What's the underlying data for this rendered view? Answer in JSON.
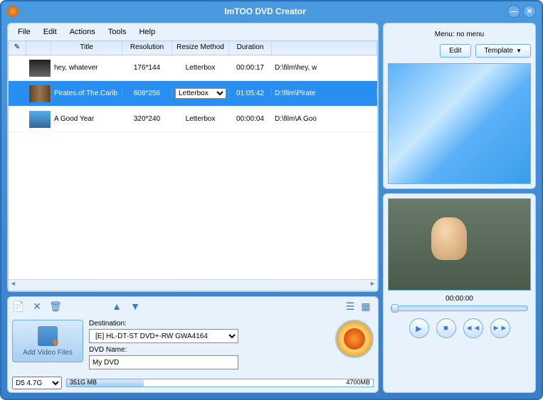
{
  "app_title": "ImTOO DVD Creator",
  "menubar": [
    "File",
    "Edit",
    "Actions",
    "Tools",
    "Help"
  ],
  "columns": {
    "edit": "",
    "thumb": "",
    "title": "Title",
    "resolution": "Resolution",
    "resize": "Resize Method",
    "duration": "Duration",
    "path": ""
  },
  "rows": [
    {
      "title": "hey, whatever",
      "res": "176*144",
      "resize": "Letterbox",
      "duration": "00:00:17",
      "path": "D:\\film\\hey, w"
    },
    {
      "title": "Pirates.of.The.Carib",
      "res": "608*256",
      "resize": "Letterbox",
      "duration": "01:05:42",
      "path": "D:\\film\\Pirate"
    },
    {
      "title": "A Good Year",
      "res": "320*240",
      "resize": "Letterbox",
      "duration": "00:00:04",
      "path": "D:\\film\\A Goo"
    }
  ],
  "resize_options": [
    "Letterbox"
  ],
  "add_button": "Add Video Files",
  "destination_label": "Destination:",
  "destination_value": "[E] HL-DT-ST DVD+-RW GWA4164",
  "dvdname_label": "DVD Name:",
  "dvdname_value": "My DVD",
  "capacity_type": "D5  4.7G",
  "capacity_used": "351G MB",
  "capacity_total": "4700MB",
  "menu_label": "Menu:  no menu",
  "edit_button": "Edit",
  "template_button": "Template",
  "playback_time": "00:00:00"
}
